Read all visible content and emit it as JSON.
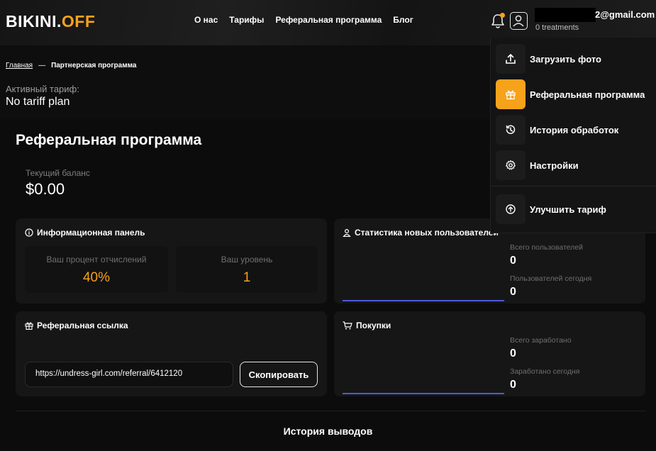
{
  "header": {
    "logo_part1": "BIKINI.",
    "logo_part2": "OFF",
    "nav": [
      "О нас",
      "Тарифы",
      "Реферальная программа",
      "Блог"
    ],
    "email_suffix": "2@gmail.com",
    "treatments": "0 treatments"
  },
  "breadcrumb": {
    "home": "Главная",
    "separator": "—",
    "current": "Партнерская программа"
  },
  "tariff": {
    "label": "Активный тариф:",
    "value": "No tariff plan"
  },
  "page": {
    "title": "Реферальная программа",
    "balance_label": "Текущий баланс",
    "balance_value": "$0.00"
  },
  "info_panel": {
    "title": "Информационная панель",
    "percent_label": "Ваш процент отчислений",
    "percent_value": "40%",
    "level_label": "Ваш уровень",
    "level_value": "1"
  },
  "new_users": {
    "title": "Статистика новых пользователей",
    "total_label": "Всего пользователей",
    "total_value": "0",
    "today_label": "Пользователей сегодня",
    "today_value": "0"
  },
  "referral": {
    "title": "Реферальная ссылка",
    "link": "https://undress-girl.com/referral/6412120",
    "copy_label": "Скопировать"
  },
  "purchases": {
    "title": "Покупки",
    "total_label": "Всего заработано",
    "total_value": "0",
    "today_label": "Заработано сегодня",
    "today_value": "0"
  },
  "history": {
    "title": "История выводов"
  },
  "dropdown": {
    "items": [
      {
        "label": "Загрузить фото",
        "icon": "upload-icon"
      },
      {
        "label": "Реферальная программа",
        "icon": "gift-icon"
      },
      {
        "label": "История обработок",
        "icon": "history-icon"
      },
      {
        "label": "Настройки",
        "icon": "gear-icon"
      },
      {
        "label": "Улучшить тариф",
        "icon": "arrow-up-circle-icon"
      }
    ]
  },
  "colors": {
    "accent": "#f7a21b",
    "chart_line": "#4b5bdc",
    "background": "#0e0e0e"
  }
}
